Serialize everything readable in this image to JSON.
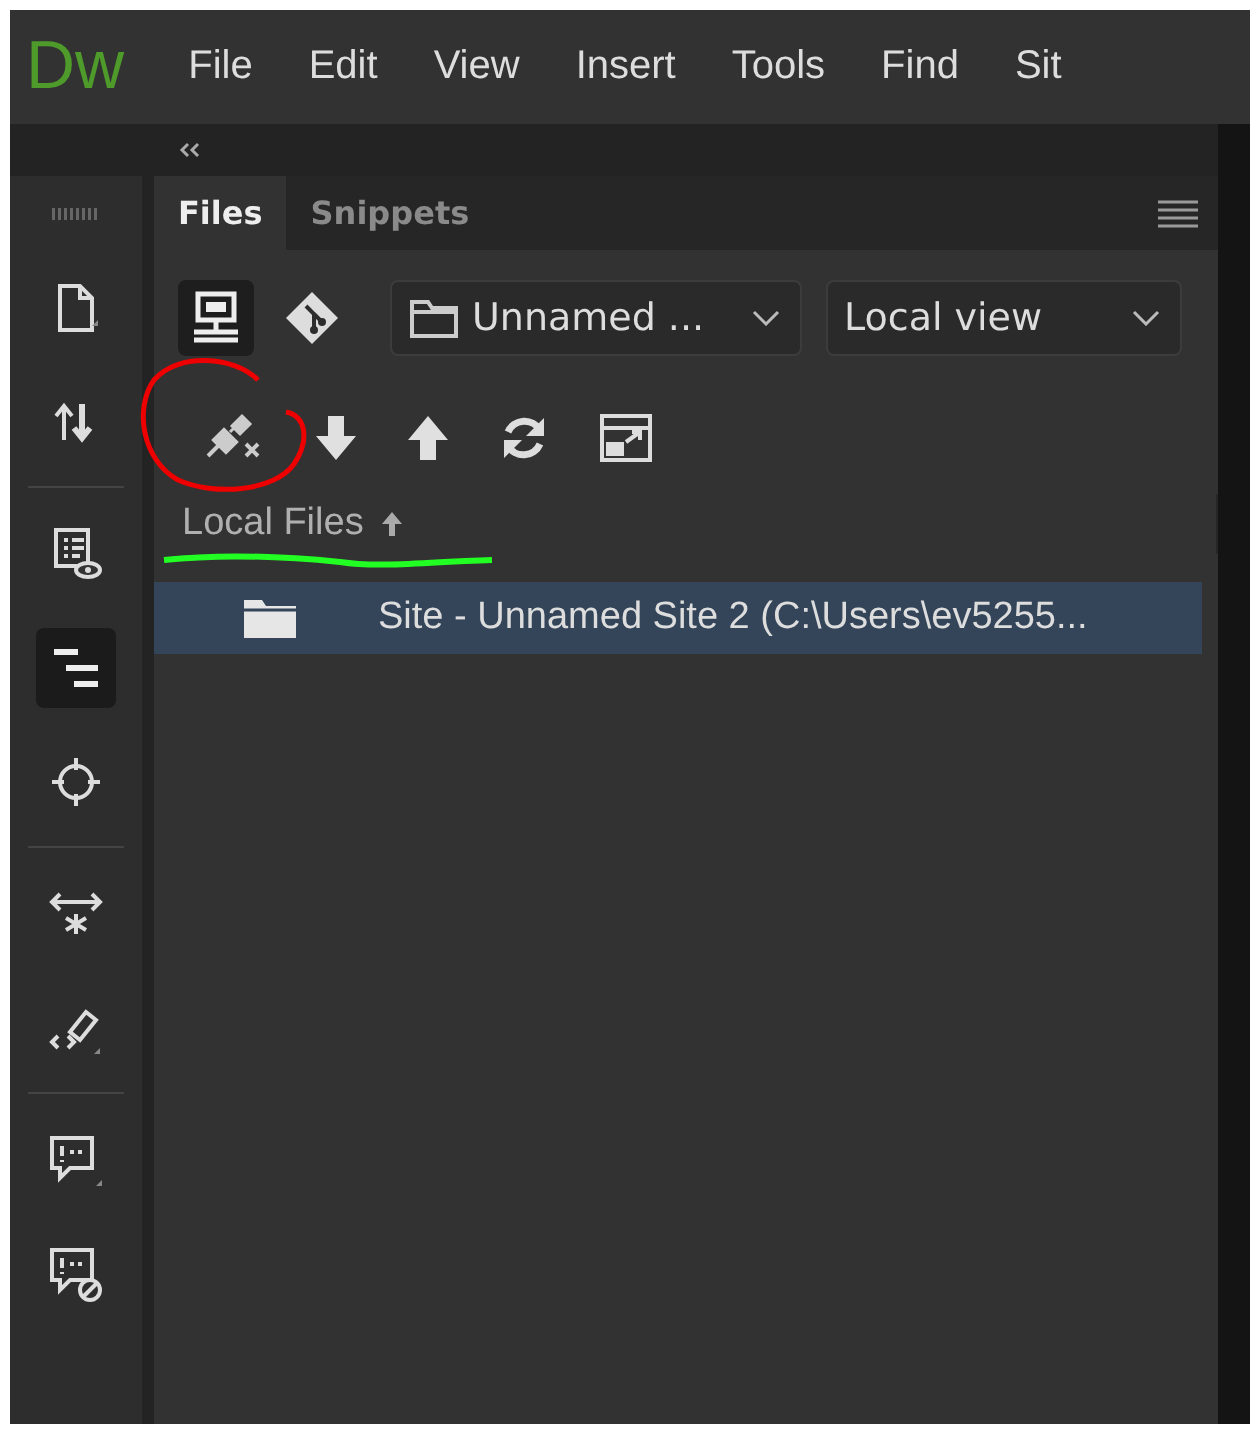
{
  "app": {
    "logo": "Dw"
  },
  "menu": [
    "File",
    "Edit",
    "View",
    "Insert",
    "Tools",
    "Find",
    "Sit"
  ],
  "left_toolbar": {
    "groups": [
      [
        {
          "kind": "file",
          "selected": false
        },
        {
          "kind": "transfer",
          "selected": false
        }
      ],
      [
        {
          "kind": "preview",
          "selected": false
        },
        {
          "kind": "outline",
          "selected": true
        },
        {
          "kind": "target",
          "selected": false
        }
      ],
      [
        {
          "kind": "resize",
          "selected": false
        },
        {
          "kind": "code",
          "selected": false
        }
      ],
      [
        {
          "kind": "comment",
          "selected": false
        },
        {
          "kind": "comment-off",
          "selected": false
        }
      ]
    ]
  },
  "panel": {
    "tabs": [
      {
        "label": "Files",
        "selected": true
      },
      {
        "label": "Snippets",
        "selected": false
      }
    ],
    "view_buttons": [
      {
        "kind": "server",
        "selected": true
      },
      {
        "kind": "git",
        "selected": false
      }
    ],
    "site_select": {
      "value": "Unnamed ..."
    },
    "view_select": {
      "value": "Local view"
    },
    "toolbar": [
      {
        "kind": "disconnect"
      },
      {
        "kind": "get"
      },
      {
        "kind": "put"
      },
      {
        "kind": "refresh"
      },
      {
        "kind": "expand"
      }
    ],
    "file_list": {
      "header": "Local Files",
      "rows": [
        {
          "label": "Site - Unnamed Site 2 (C:\\Users\\ev5255...",
          "selected": true
        }
      ]
    }
  }
}
